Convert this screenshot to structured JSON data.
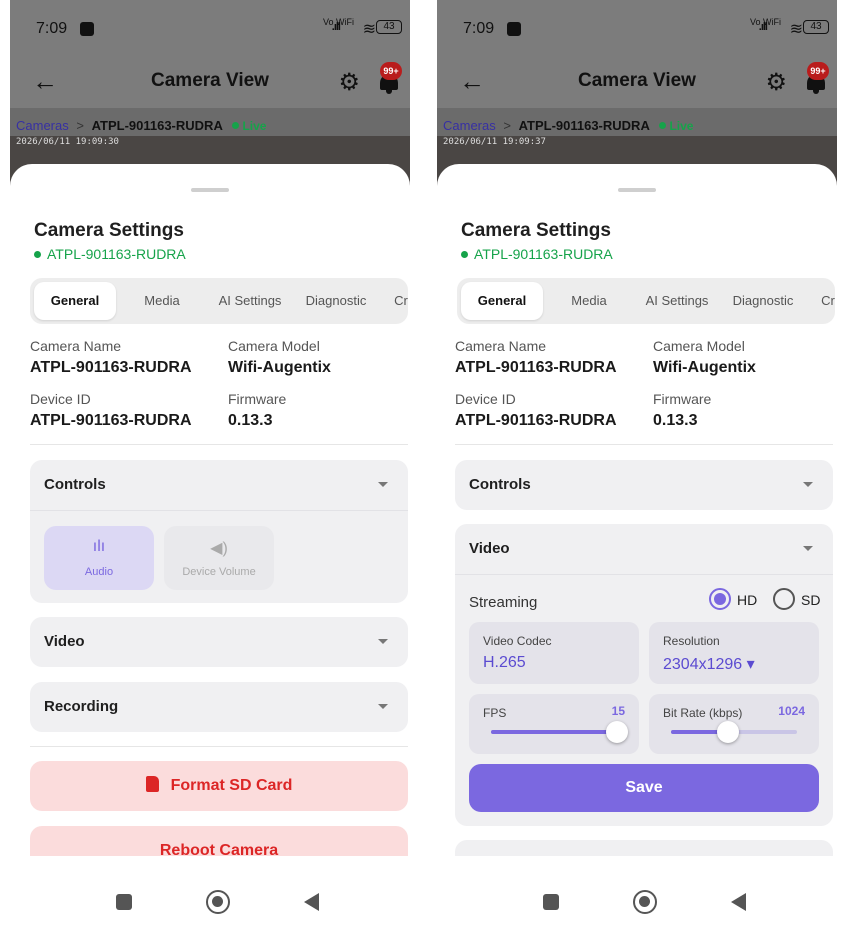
{
  "left": {
    "status": {
      "time": "7:09",
      "signal": ".ıll",
      "wifi_label": "Vo WiFi",
      "battery": "43"
    },
    "appbar": {
      "title": "Camera View",
      "badge": "99+"
    },
    "breadcrumb": {
      "root": "Cameras",
      "sep": ">",
      "camera": "ATPL-901163-RUDRA",
      "live": "Live"
    },
    "timestamp": "2026/06/11 19:09:30",
    "sheet": {
      "title": "Camera Settings",
      "subtitle": "ATPL-901163-RUDRA"
    },
    "tabs": [
      "General",
      "Media",
      "AI Settings",
      "Diagnostic",
      "Cr"
    ],
    "info": {
      "camera_name_label": "Camera Name",
      "camera_name": "ATPL-901163-RUDRA",
      "camera_model_label": "Camera Model",
      "camera_model": "Wifi-Augentix",
      "device_id_label": "Device ID",
      "device_id": "ATPL-901163-RUDRA",
      "firmware_label": "Firmware",
      "firmware": "0.13.3"
    },
    "controls": {
      "title": "Controls",
      "audio": "Audio",
      "device_volume": "Device Volume"
    },
    "video": {
      "title": "Video"
    },
    "recording": {
      "title": "Recording"
    },
    "format_sd": "Format SD Card",
    "reboot": "Reboot Camera"
  },
  "right": {
    "status": {
      "time": "7:09",
      "signal": ".ıll",
      "wifi_label": "Vo WiFi",
      "battery": "43"
    },
    "appbar": {
      "title": "Camera View",
      "badge": "99+"
    },
    "breadcrumb": {
      "root": "Cameras",
      "sep": ">",
      "camera": "ATPL-901163-RUDRA",
      "live": "Live"
    },
    "timestamp": "2026/06/11 19:09:37",
    "sheet": {
      "title": "Camera Settings",
      "subtitle": "ATPL-901163-RUDRA"
    },
    "tabs": [
      "General",
      "Media",
      "AI Settings",
      "Diagnostic",
      "Cr"
    ],
    "info": {
      "camera_name_label": "Camera Name",
      "camera_name": "ATPL-901163-RUDRA",
      "camera_model_label": "Camera Model",
      "camera_model": "Wifi-Augentix",
      "device_id_label": "Device ID",
      "device_id": "ATPL-901163-RUDRA",
      "firmware_label": "Firmware",
      "firmware": "0.13.3"
    },
    "controls": {
      "title": "Controls"
    },
    "video": {
      "title": "Video",
      "streaming_label": "Streaming",
      "hd": "HD",
      "sd": "SD",
      "codec_label": "Video Codec",
      "codec": "H.265",
      "resolution_label": "Resolution",
      "resolution": "2304x1296 ▾",
      "fps_label": "FPS",
      "fps": "15",
      "fps_fraction": 1.0,
      "bitrate_label": "Bit Rate (kbps)",
      "bitrate": "1024",
      "bitrate_fraction": 0.45,
      "save": "Save"
    }
  },
  "colors": {
    "accent": "#7b68e0",
    "live": "#16a34a",
    "danger": "#dc2626"
  }
}
